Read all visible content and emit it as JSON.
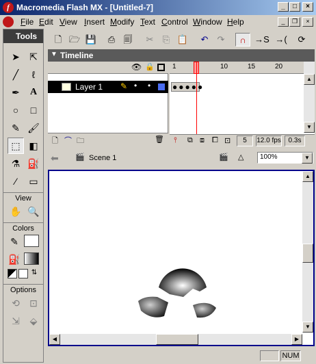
{
  "window": {
    "title": "Macromedia Flash MX - [Untitled-7]"
  },
  "menu": [
    {
      "label": "File",
      "ul": "F",
      "rest": "ile"
    },
    {
      "label": "Edit",
      "ul": "E",
      "rest": "dit"
    },
    {
      "label": "View",
      "ul": "V",
      "rest": "iew"
    },
    {
      "label": "Insert",
      "ul": "I",
      "rest": "nsert"
    },
    {
      "label": "Modify",
      "ul": "M",
      "rest": "odify"
    },
    {
      "label": "Text",
      "ul": "T",
      "rest": "ext"
    },
    {
      "label": "Control",
      "ul": "C",
      "rest": "ontrol"
    },
    {
      "label": "Window",
      "ul": "W",
      "rest": "indow"
    },
    {
      "label": "Help",
      "ul": "H",
      "rest": "elp"
    }
  ],
  "tools": {
    "title": "Tools",
    "view_label": "View",
    "colors_label": "Colors",
    "options_label": "Options"
  },
  "timeline": {
    "title": "Timeline",
    "layer_name": "Layer 1",
    "frame_numbers": [
      "1",
      "5",
      "10",
      "15",
      "20"
    ],
    "current_frame": "5",
    "fps": "12.0 fps",
    "time": "0.3s"
  },
  "scene": {
    "name": "Scene 1",
    "zoom": "100%"
  },
  "status": {
    "num": "NUM"
  },
  "colors": {
    "accent": "#0a246a",
    "playhead": "#ff0000",
    "layer_color": "#4a6cf0"
  }
}
